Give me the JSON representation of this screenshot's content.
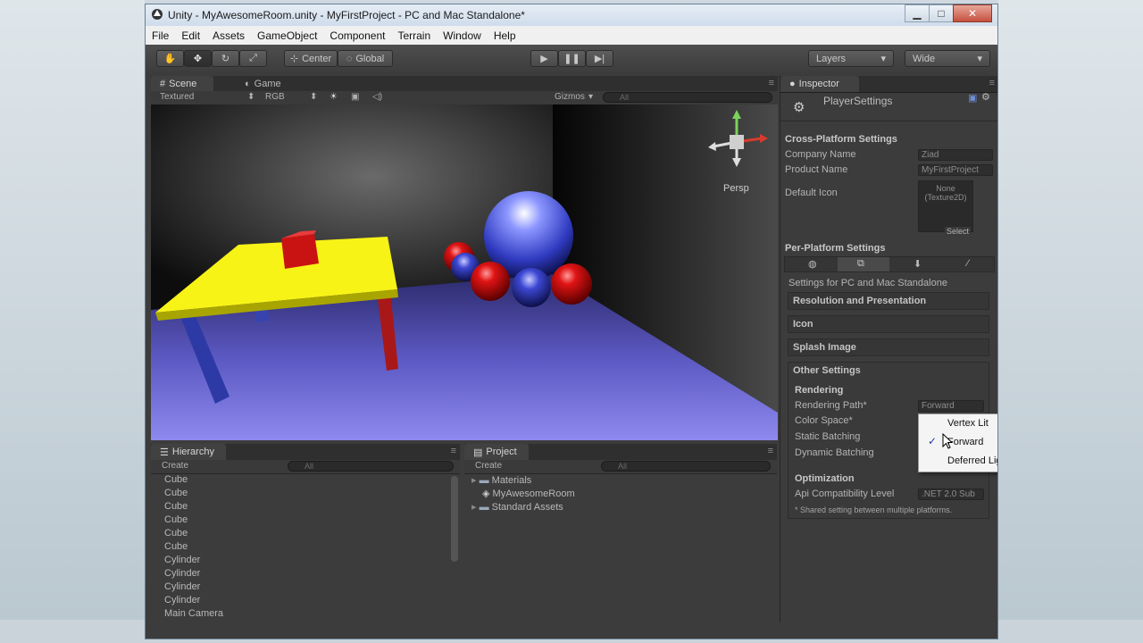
{
  "window": {
    "title": "Unity - MyAwesomeRoom.unity - MyFirstProject - PC and Mac Standalone*"
  },
  "menu": [
    "File",
    "Edit",
    "Assets",
    "GameObject",
    "Component",
    "Terrain",
    "Window",
    "Help"
  ],
  "toolbar": {
    "pivot": "Center",
    "space": "Global",
    "layers": "Layers",
    "layout": "Wide"
  },
  "scene": {
    "tab_scene": "Scene",
    "tab_game": "Game",
    "render_mode": "Textured",
    "color_mode": "RGB",
    "gizmos": "Gizmos",
    "search_placeholder": "All",
    "projection": "Persp"
  },
  "hierarchy": {
    "tab": "Hierarchy",
    "create": "Create",
    "search_placeholder": "All",
    "items": [
      "Cube",
      "Cube",
      "Cube",
      "Cube",
      "Cube",
      "Cube",
      "Cylinder",
      "Cylinder",
      "Cylinder",
      "Cylinder",
      "Main Camera"
    ]
  },
  "project": {
    "tab": "Project",
    "create": "Create",
    "search_placeholder": "All",
    "items": [
      "Materials",
      "MyAwesomeRoom",
      "Standard Assets"
    ]
  },
  "inspector": {
    "tab": "Inspector",
    "header": "PlayerSettings",
    "cross_platform": "Cross-Platform Settings",
    "company_label": "Company Name",
    "company_value": "Ziad",
    "product_label": "Product Name",
    "product_value": "MyFirstProject",
    "default_icon_label": "Default Icon",
    "icon_none": "None",
    "icon_type": "(Texture2D)",
    "select": "Select",
    "per_platform": "Per-Platform Settings",
    "platform_settings_for": "Settings for PC and Mac Standalone",
    "sections": [
      "Resolution and Presentation",
      "Icon",
      "Splash Image"
    ],
    "other_settings": "Other Settings",
    "rendering": "Rendering",
    "rendering_path_label": "Rendering Path*",
    "rendering_path_value": "Forward",
    "color_space_label": "Color Space*",
    "static_batching_label": "Static Batching",
    "dynamic_batching_label": "Dynamic Batching",
    "optimization": "Optimization",
    "api_label": "Api Compatibility Level",
    "api_value": ".NET 2.0 Sub",
    "shared_note": "* Shared setting between multiple platforms."
  },
  "dropdown": {
    "options": [
      "Vertex Lit",
      "Forward",
      "Deferred Lig"
    ],
    "checkmark": "✓"
  }
}
